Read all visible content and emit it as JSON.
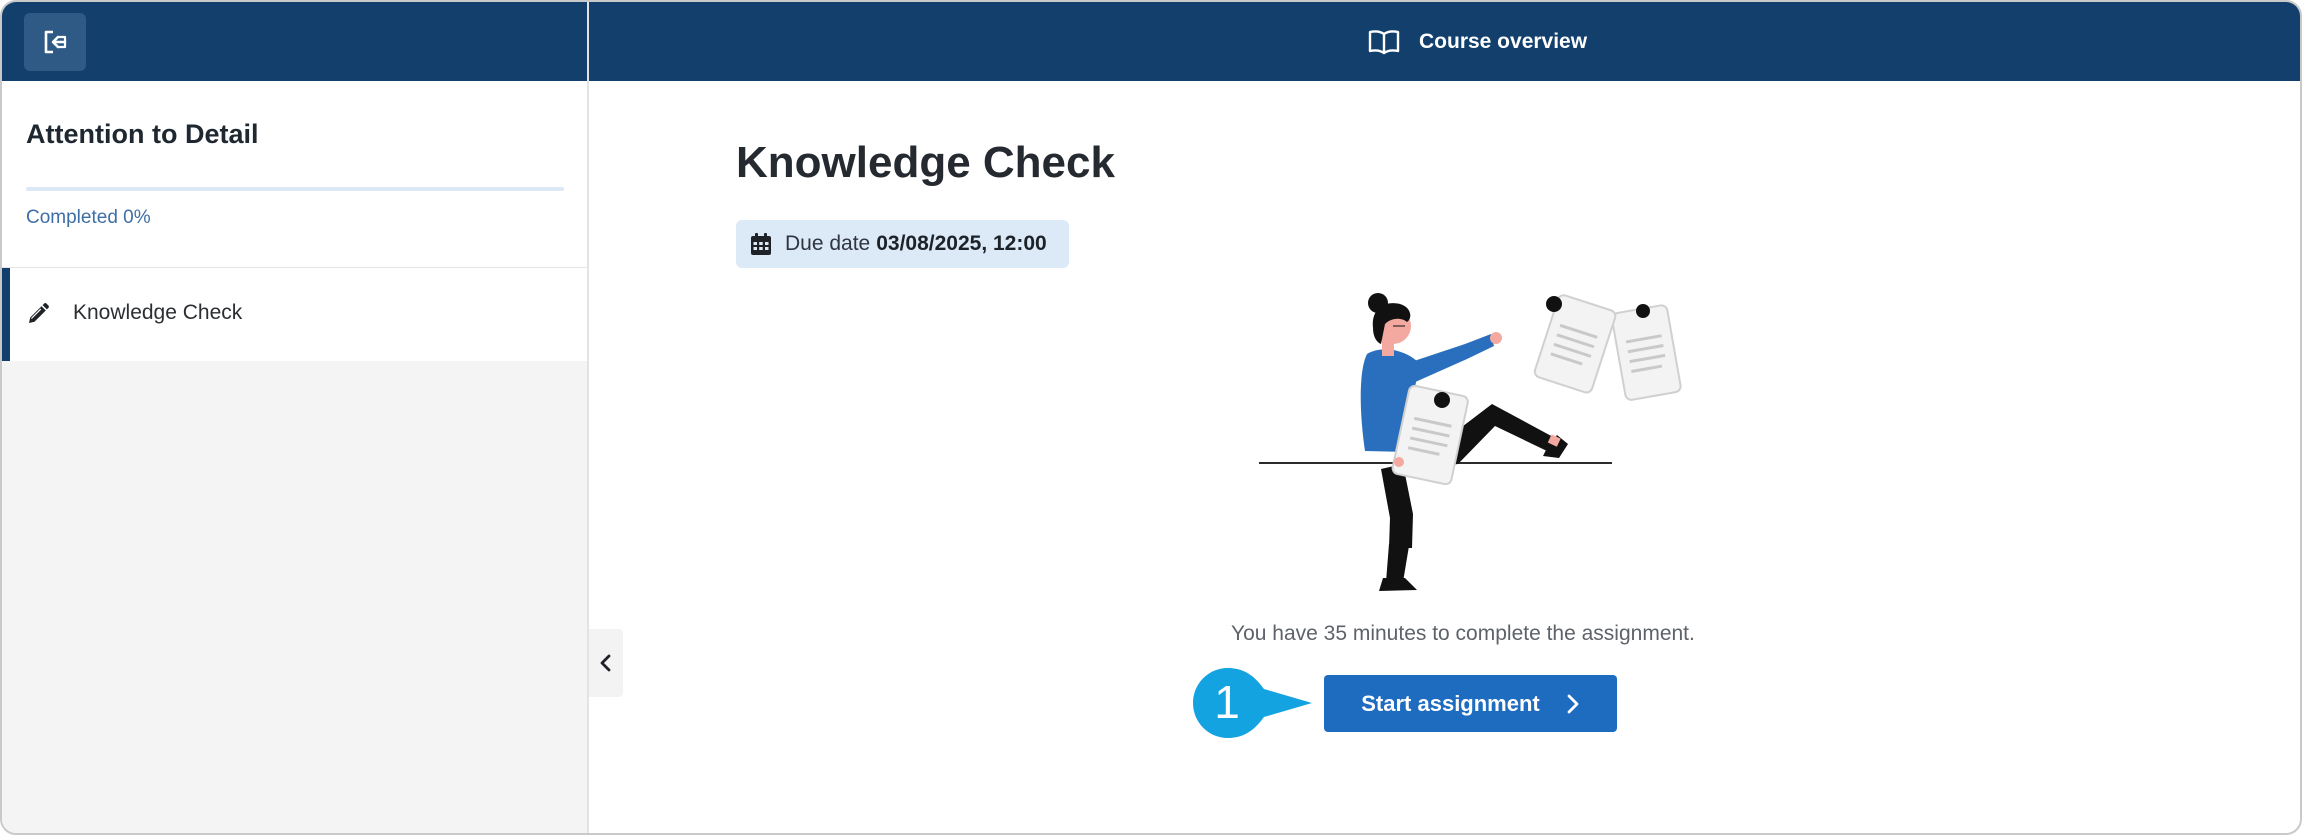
{
  "sidebar": {
    "exit_icon": "exit-icon",
    "course_title": "Attention to Detail",
    "progress_percent": 0,
    "progress_label": "Completed 0%",
    "items": [
      {
        "label": "Knowledge Check",
        "icon": "pencil-icon",
        "active": true
      }
    ],
    "collapse_icon": "chevron-left-icon"
  },
  "header": {
    "overview_icon": "open-book-icon",
    "overview_label": "Course overview"
  },
  "main": {
    "title": "Knowledge Check",
    "due_icon": "calendar-icon",
    "due_label": "Due date",
    "due_value": "03/08/2025, 12:00",
    "info_text": "You have 35 minutes to complete the assignment.",
    "start_button_label": "Start assignment",
    "start_button_icon": "chevron-right-icon",
    "callout_number": "1"
  },
  "colors": {
    "navy": "#123f6c",
    "button_blue": "#1e6cc0",
    "callout_cyan": "#14a3e1",
    "figure_blue": "#2a6fbe"
  }
}
